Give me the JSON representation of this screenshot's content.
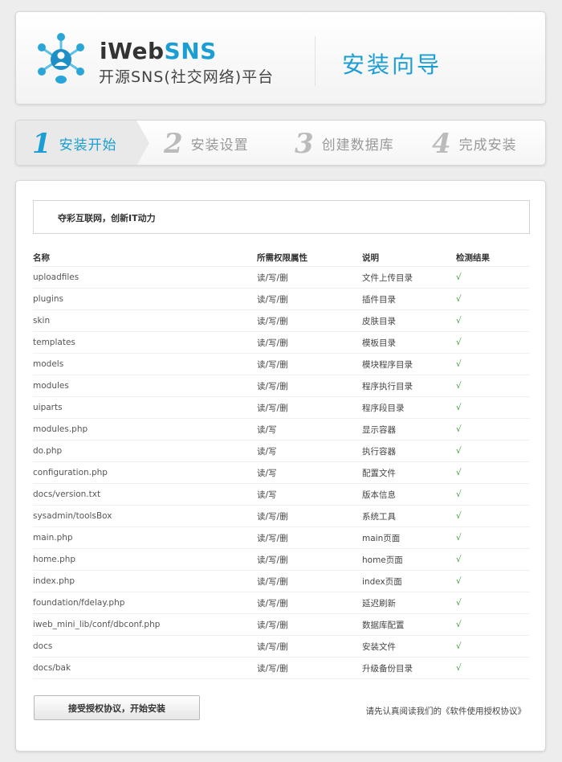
{
  "header": {
    "brand_main": "iWeb",
    "brand_accent": "SNS",
    "brand_sub": "开源SNS(社交网络)平台",
    "wizard_title": "安装向导"
  },
  "steps": [
    {
      "num": "1",
      "label": "安装开始",
      "active": true
    },
    {
      "num": "2",
      "label": "安装设置",
      "active": false
    },
    {
      "num": "3",
      "label": "创建数据库",
      "active": false
    },
    {
      "num": "4",
      "label": "完成安装",
      "active": false
    }
  ],
  "slogan": "夺彩互联网，创新IT动力",
  "table": {
    "headers": [
      "名称",
      "所需权限属性",
      "说明",
      "检测结果"
    ],
    "rows": [
      [
        "uploadfiles",
        "读/写/删",
        "文件上传目录",
        "√"
      ],
      [
        "plugins",
        "读/写/删",
        "插件目录",
        "√"
      ],
      [
        "skin",
        "读/写/删",
        "皮肤目录",
        "√"
      ],
      [
        "templates",
        "读/写/删",
        "模板目录",
        "√"
      ],
      [
        "models",
        "读/写/删",
        "模块程序目录",
        "√"
      ],
      [
        "modules",
        "读/写/删",
        "程序执行目录",
        "√"
      ],
      [
        "uiparts",
        "读/写/删",
        "程序段目录",
        "√"
      ],
      [
        "modules.php",
        "读/写",
        "显示容器",
        "√"
      ],
      [
        "do.php",
        "读/写",
        "执行容器",
        "√"
      ],
      [
        "configuration.php",
        "读/写",
        "配置文件",
        "√"
      ],
      [
        "docs/version.txt",
        "读/写",
        "版本信息",
        "√"
      ],
      [
        "sysadmin/toolsBox",
        "读/写/删",
        "系统工具",
        "√"
      ],
      [
        "main.php",
        "读/写/删",
        "main页面",
        "√"
      ],
      [
        "home.php",
        "读/写/删",
        "home页面",
        "√"
      ],
      [
        "index.php",
        "读/写/删",
        "index页面",
        "√"
      ],
      [
        "foundation/fdelay.php",
        "读/写/删",
        "延迟刷新",
        "√"
      ],
      [
        "iweb_mini_lib/conf/dbconf.php",
        "读/写/删",
        "数据库配置",
        "√"
      ],
      [
        "docs",
        "读/写/删",
        "安装文件",
        "√"
      ],
      [
        "docs/bak",
        "读/写/删",
        "升级备份目录",
        "√"
      ]
    ]
  },
  "footer": {
    "accept_button": "接受授权协议，开始安装",
    "license_note": "请先认真阅读我们的《软件使用授权协议》"
  },
  "colors": {
    "accent": "#1a9ed3",
    "check": "#3a9a3a",
    "step_inactive": "#bbbbbb"
  }
}
